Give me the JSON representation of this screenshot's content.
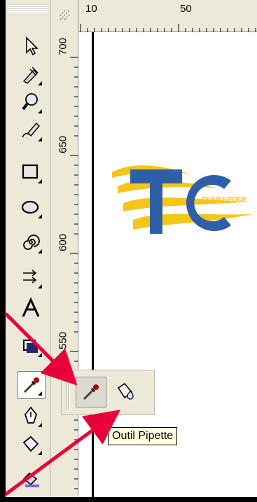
{
  "ruler_top": {
    "labels": [
      "10",
      "50"
    ]
  },
  "ruler_left": {
    "labels": [
      "700",
      "650",
      "600",
      "550"
    ]
  },
  "toolbox": {
    "tools": [
      "pick-tool",
      "shape-tool",
      "zoom-tool",
      "freehand-tool",
      "rectangle-tool",
      "ellipse-tool",
      "spiral-tool",
      "interactive-blend-tool",
      "text-tool",
      "interactive-fill-tool",
      "eyedropper-tool",
      "outline-pen-tool",
      "fill-tool",
      "interactive-fill-tool-2"
    ]
  },
  "flyout": {
    "buttons": [
      "eyedropper-tool",
      "paintbucket-tool"
    ]
  },
  "tooltip": {
    "text": "Outil Pipette"
  },
  "logo": {
    "main_text": "TC",
    "sub_text": "DUNKERQUE",
    "colors": {
      "blue": "#2f5fa8",
      "yellow": "#f5c518"
    }
  },
  "annotations": {
    "arrow_color": "#e8003a"
  }
}
